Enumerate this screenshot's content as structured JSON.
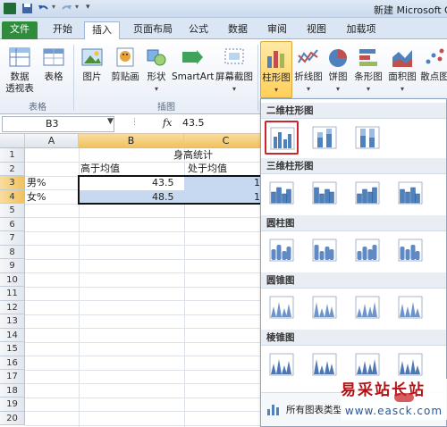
{
  "window": {
    "title": "新建 Microsoft O"
  },
  "tabs": [
    {
      "label": "文件"
    },
    {
      "label": "开始"
    },
    {
      "label": "插入"
    },
    {
      "label": "页面布局"
    },
    {
      "label": "公式"
    },
    {
      "label": "数据"
    },
    {
      "label": "审阅"
    },
    {
      "label": "视图"
    },
    {
      "label": "加载项"
    }
  ],
  "ribbon": {
    "buttons": [
      {
        "label": "数据\n透视表",
        "icon": "pivot-table-icon"
      },
      {
        "label": "表格",
        "icon": "table-icon"
      },
      {
        "label": "图片",
        "icon": "picture-icon"
      },
      {
        "label": "剪贴画",
        "icon": "clipart-icon"
      },
      {
        "label": "形状",
        "icon": "shapes-icon"
      },
      {
        "label": "SmartArt",
        "icon": "smartart-icon"
      },
      {
        "label": "屏幕截图",
        "icon": "screenshot-icon"
      },
      {
        "label": "柱形图",
        "icon": "column-chart-icon"
      },
      {
        "label": "折线图",
        "icon": "line-chart-icon"
      },
      {
        "label": "饼图",
        "icon": "pie-chart-icon"
      },
      {
        "label": "条形图",
        "icon": "bar-chart-icon"
      },
      {
        "label": "面积图",
        "icon": "area-chart-icon"
      },
      {
        "label": "散点图",
        "icon": "scatter-chart-icon"
      }
    ],
    "groups": {
      "tables": "表格",
      "illustrations": "插图"
    }
  },
  "formula_bar": {
    "name_box": "B3",
    "fx": "fx",
    "value": "43.5"
  },
  "sheet": {
    "columns": [
      "A",
      "B",
      "C"
    ],
    "rows": [
      "1",
      "2",
      "3",
      "4",
      "5",
      "6",
      "7",
      "8",
      "9",
      "10",
      "11",
      "12",
      "13",
      "14",
      "15",
      "16",
      "17",
      "18",
      "19",
      "20"
    ],
    "cells": {
      "title": "身高统计",
      "b2": "高于均值",
      "c2": "处于均值",
      "a3": "男%",
      "b3": "43.5",
      "c3": "1",
      "a4": "女%",
      "b4": "48.5",
      "c4": "1"
    }
  },
  "dropdown": {
    "sections": [
      "二维柱形图",
      "三维柱形图",
      "圆柱图",
      "圆锥图",
      "棱锥图"
    ],
    "all_charts": "所有图表类型..."
  },
  "watermark": {
    "line1": "易采站长站",
    "line2": "www.easck.com"
  },
  "colors": {
    "accent": "#2f8c3b",
    "selection": "#c8262b",
    "chart_blue": "#4f81bd"
  }
}
